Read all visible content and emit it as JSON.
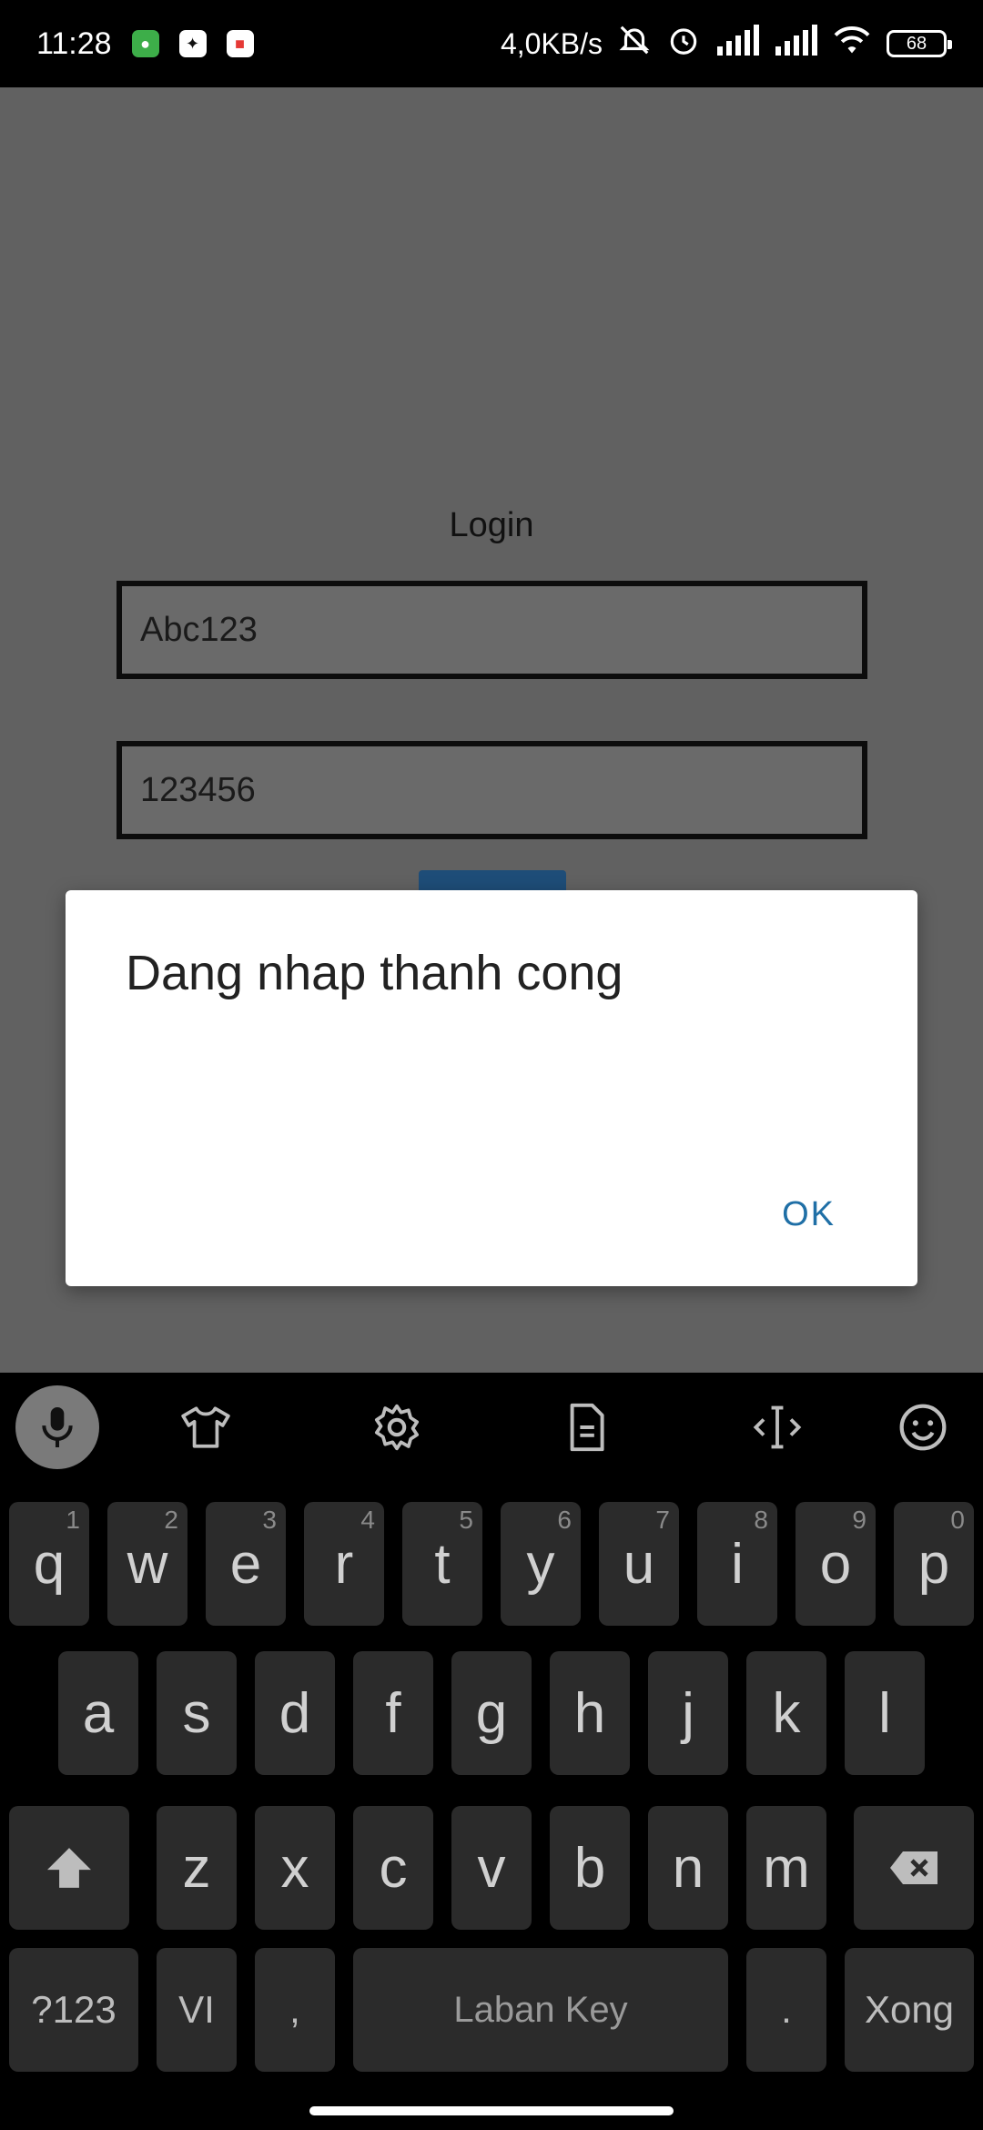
{
  "status_bar": {
    "time": "11:28",
    "network_speed": "4,0KB/s",
    "battery": "68"
  },
  "login": {
    "title": "Login",
    "username_value": "Abc123",
    "password_value": "123456"
  },
  "dialog": {
    "message": "Dang nhap thanh cong",
    "ok_label": "OK"
  },
  "keyboard": {
    "row1": [
      {
        "key": "q",
        "hint": "1"
      },
      {
        "key": "w",
        "hint": "2"
      },
      {
        "key": "e",
        "hint": "3"
      },
      {
        "key": "r",
        "hint": "4"
      },
      {
        "key": "t",
        "hint": "5"
      },
      {
        "key": "y",
        "hint": "6"
      },
      {
        "key": "u",
        "hint": "7"
      },
      {
        "key": "i",
        "hint": "8"
      },
      {
        "key": "o",
        "hint": "9"
      },
      {
        "key": "p",
        "hint": "0"
      }
    ],
    "row2": [
      "a",
      "s",
      "d",
      "f",
      "g",
      "h",
      "j",
      "k",
      "l"
    ],
    "row3": [
      "z",
      "x",
      "c",
      "v",
      "b",
      "n",
      "m"
    ],
    "symbols_label": "?123",
    "language_label": "VI",
    "comma_label": ",",
    "space_label": "Laban Key",
    "period_label": ".",
    "enter_label": "Xong"
  }
}
